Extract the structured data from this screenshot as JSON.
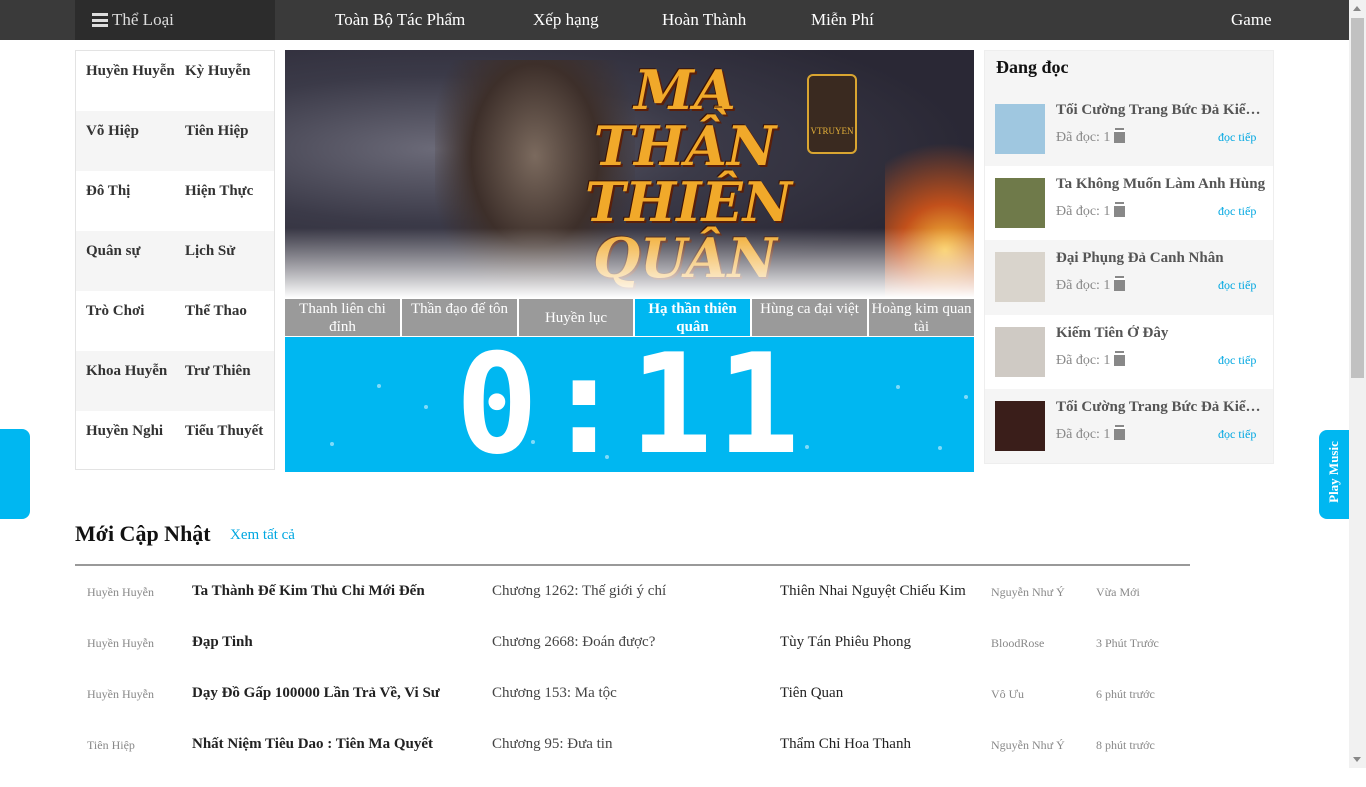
{
  "nav": {
    "category_label": "Thể Loại",
    "items": [
      {
        "label": "Toàn Bộ Tác Phẩm"
      },
      {
        "label": "Xếp hạng"
      },
      {
        "label": "Hoàn Thành"
      },
      {
        "label": "Miễn Phí"
      },
      {
        "label": "Game"
      }
    ]
  },
  "genres": [
    [
      "Huyền Huyễn",
      "Kỳ Huyễn"
    ],
    [
      "Võ Hiệp",
      "Tiên Hiệp"
    ],
    [
      "Đô Thị",
      "Hiện Thực"
    ],
    [
      "Quân sự",
      "Lịch Sử"
    ],
    [
      "Trò Chơi",
      "Thể Thao"
    ],
    [
      "Khoa Huyễn",
      "Trư Thiên"
    ],
    [
      "Huyền Nghi",
      "Tiểu Thuyết"
    ]
  ],
  "banner": {
    "title": "MA THẦN THIÊN QUÂN",
    "logo_text": "VTRUYEN"
  },
  "tabs": [
    {
      "label": "Thanh liên chi đỉnh",
      "active": false
    },
    {
      "label": "Thần đạo đế tôn",
      "active": false
    },
    {
      "label": "Huyền lục",
      "active": false
    },
    {
      "label": "Hạ thần thiên quân",
      "active": true
    },
    {
      "label": "Hùng ca đại việt",
      "active": false
    },
    {
      "label": "Hoàng kim quan tài",
      "active": false
    }
  ],
  "timer": {
    "value": "0:11"
  },
  "reading": {
    "title": "Đang đọc",
    "continue_label": "đọc tiếp",
    "items": [
      {
        "name": "Tối Cường Trang Bức Đả Kiểm Hệ Thống",
        "read": "Đã đọc: 1",
        "cover_color": "#9fc7e0"
      },
      {
        "name": "Ta Không Muốn Làm Anh Hùng",
        "read": "Đã đọc: 1",
        "cover_color": "#6f7a4a"
      },
      {
        "name": "Đại Phụng Đả Canh Nhân",
        "read": "Đã đọc: 1",
        "cover_color": "#d9d4cc"
      },
      {
        "name": "Kiếm Tiên Ở Đây",
        "read": "Đã đọc: 1",
        "cover_color": "#cfcac4"
      },
      {
        "name": "Tối Cường Trang Bức Đả Kiểm Hệ Thống",
        "read": "Đã đọc: 1",
        "cover_color": "#3a1e1a"
      }
    ]
  },
  "music": {
    "label": "Play Music"
  },
  "updates": {
    "title": "Mới Cập Nhật",
    "see_all": "Xem tất cả",
    "rows": [
      {
        "genre": "Huyền Huyễn",
        "title": "Ta Thành Đế Kim Thủ Chỉ Mới Đến",
        "chapter": "Chương 1262: Thế giới ý chí",
        "author": "Thiên Nhai Nguyệt Chiếu Kim",
        "converter": "Nguyễn Như Ý",
        "time": "Vừa Mới"
      },
      {
        "genre": "Huyền Huyễn",
        "title": "Đạp Tinh",
        "chapter": "Chương 2668: Đoán được?",
        "author": "Tùy Tán Phiêu Phong",
        "converter": "BloodRose",
        "time": "3 Phút Trước"
      },
      {
        "genre": "Huyền Huyễn",
        "title": "Dạy Đồ Gấp 100000 Lần Trả Về, Vi Sư",
        "chapter": "Chương 153: Ma tộc",
        "author": "Tiên Quan",
        "converter": "Vô Ưu",
        "time": "6 phút trước"
      },
      {
        "genre": "Tiên Hiệp",
        "title": "Nhất Niệm Tiêu Dao : Tiên Ma Quyết",
        "chapter": "Chương 95: Đưa tin",
        "author": "Thẩm Chỉ Hoa Thanh",
        "converter": "Nguyễn Như Ý",
        "time": "8 phút trước"
      }
    ]
  }
}
